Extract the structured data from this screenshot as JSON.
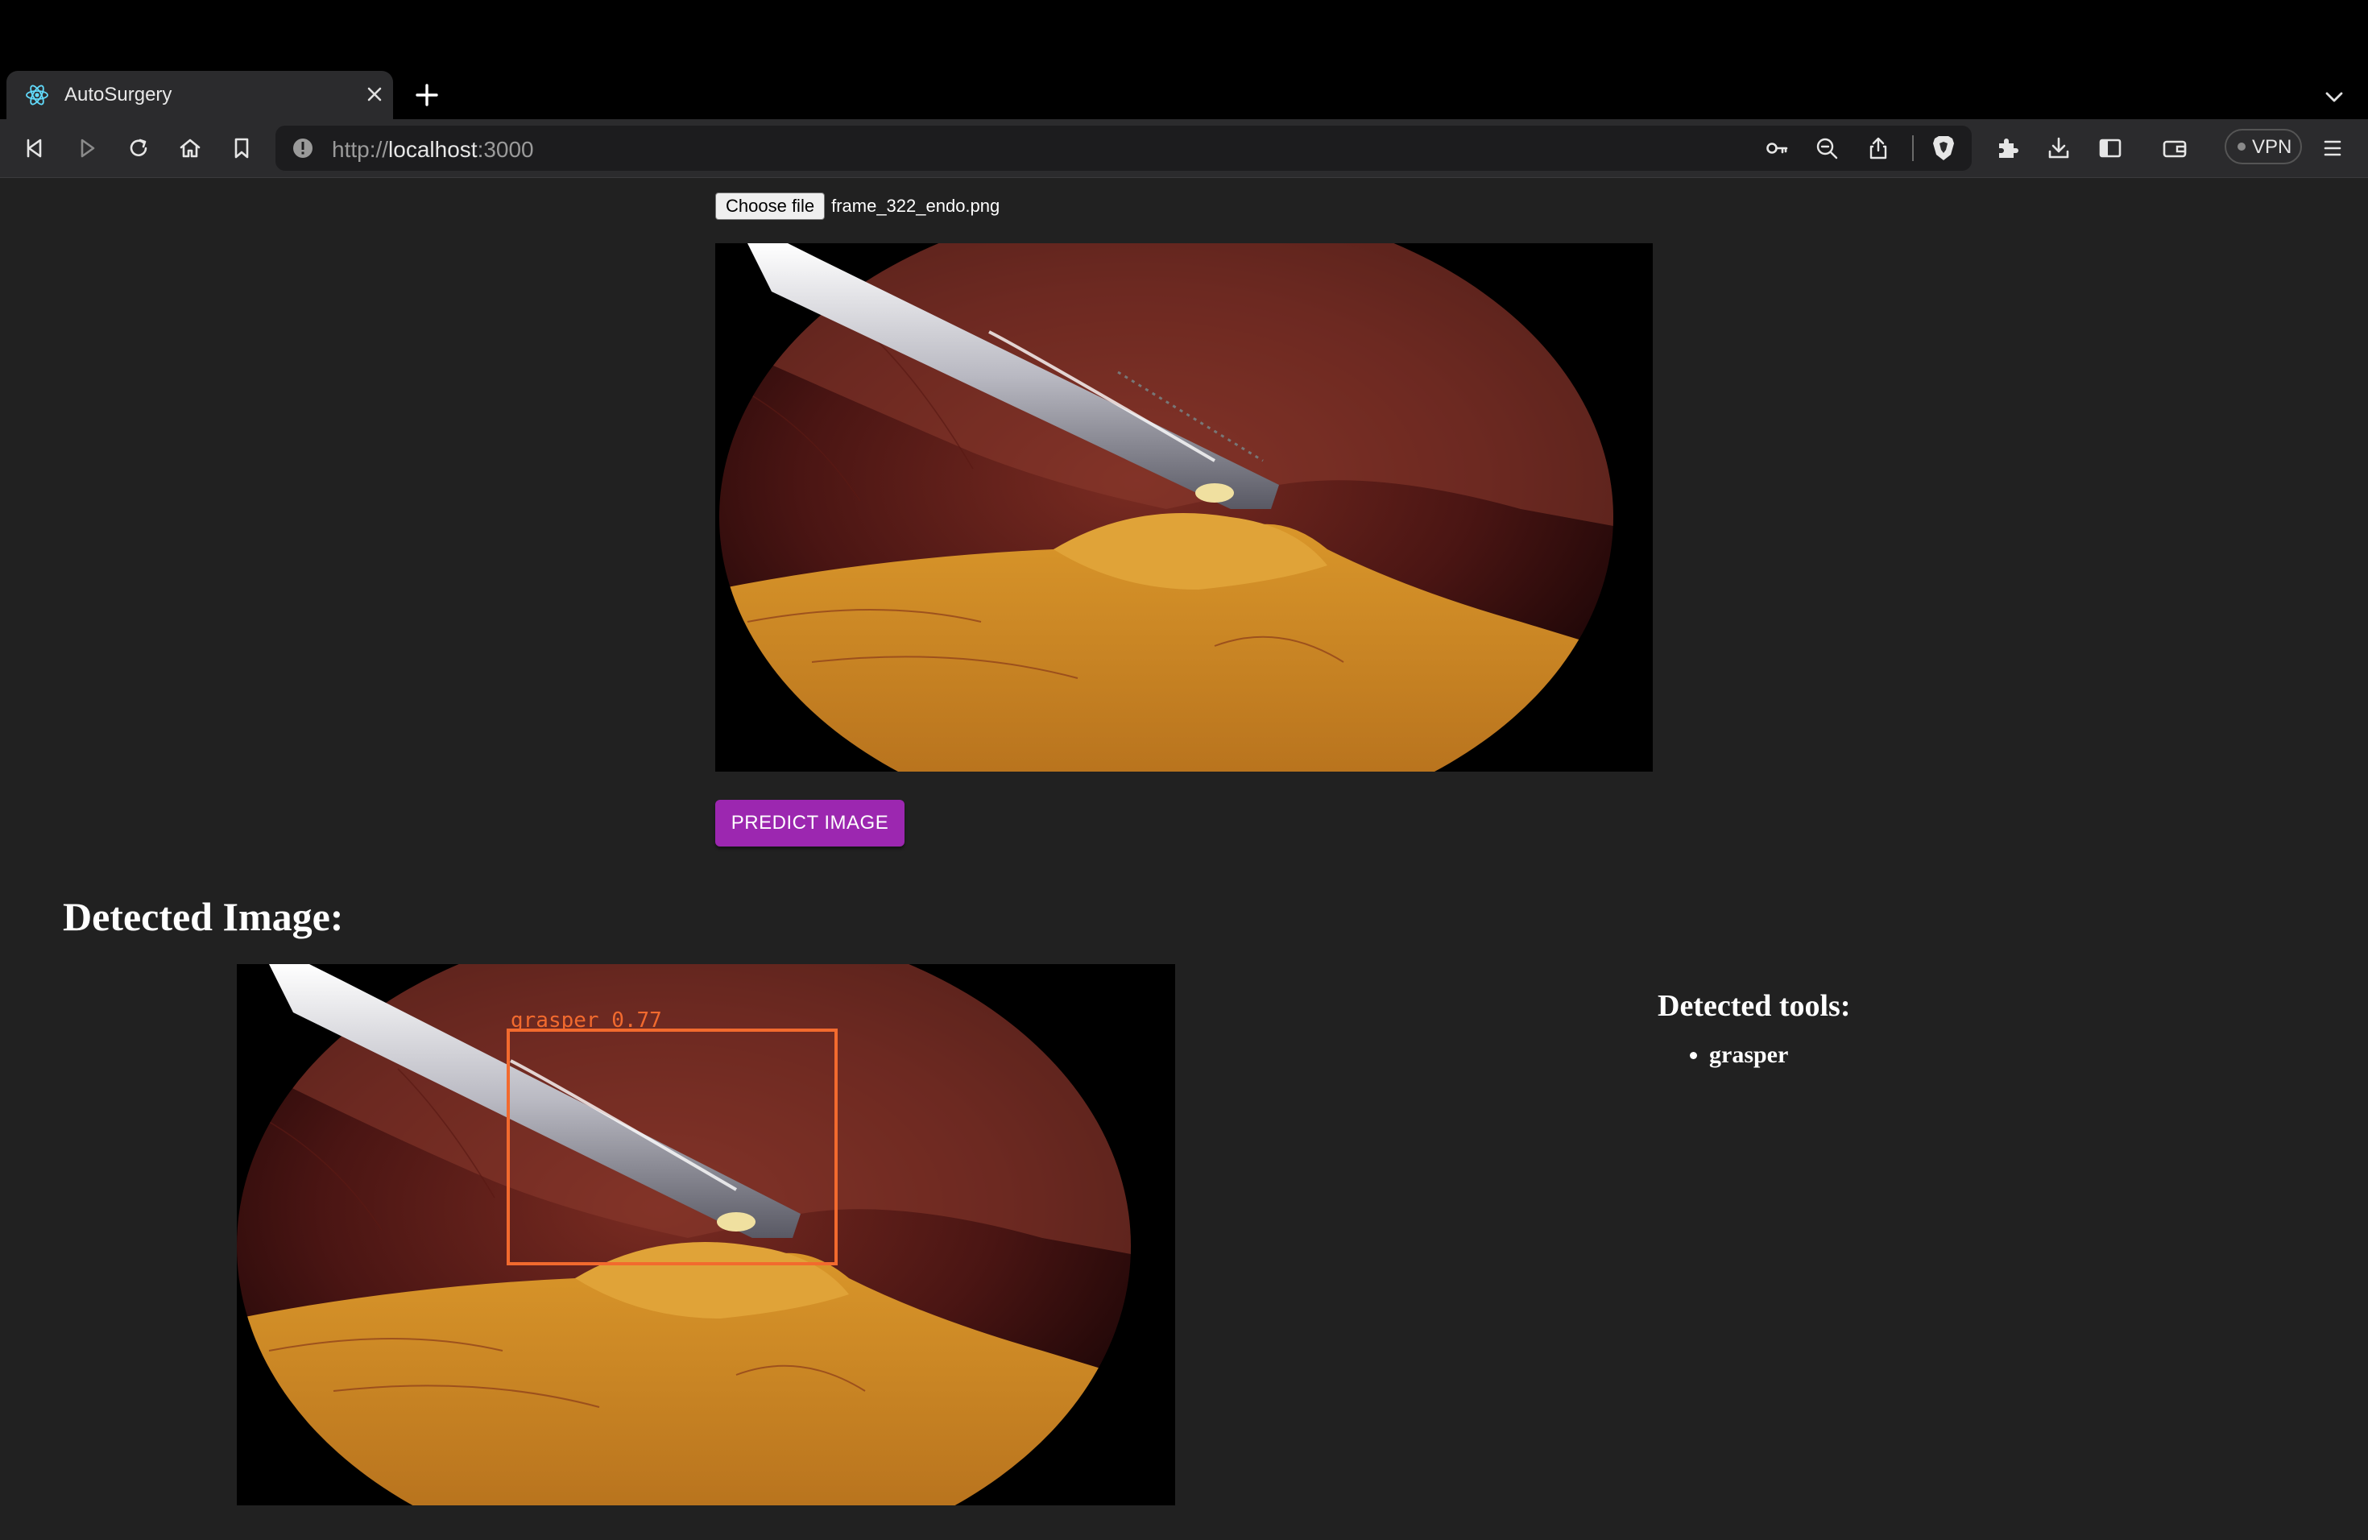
{
  "browser": {
    "tab_title": "AutoSurgery",
    "url_scheme": "http://",
    "url_host": "localhost",
    "url_port": ":3000",
    "vpn_label": "VPN"
  },
  "upload": {
    "choose_button": "Choose file",
    "file_name": "frame_322_endo.png"
  },
  "predict_button": "PREDICT IMAGE",
  "detected": {
    "heading": "Detected Image:",
    "box_label": "grasper 0.77",
    "box_color": "#f26a2e"
  },
  "tools": {
    "heading": "Detected tools:",
    "items": [
      "grasper"
    ]
  },
  "icons": [
    "react-icon",
    "close-icon",
    "plus-icon",
    "chevron-down-icon",
    "back-icon",
    "forward-icon",
    "reload-icon",
    "home-icon",
    "bookmark-icon",
    "info-icon",
    "key-icon",
    "zoom-out-icon",
    "share-icon",
    "brave-shield-icon",
    "extensions-icon",
    "download-icon",
    "sidebar-icon",
    "wallet-icon",
    "menu-icon"
  ],
  "colors": {
    "page_bg": "#212121",
    "button_purple": "#9c27b0",
    "chrome_bg": "#2b2b2d"
  }
}
